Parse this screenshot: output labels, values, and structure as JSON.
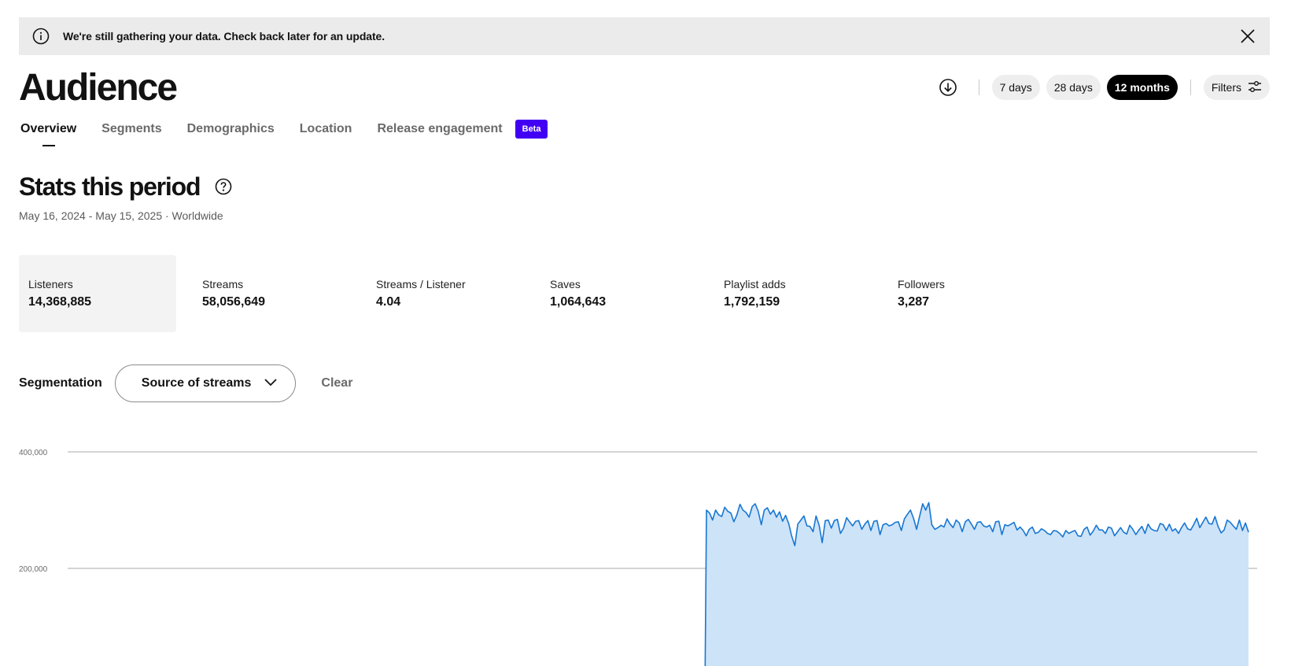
{
  "banner": {
    "message": "We're still gathering your data. Check back later for an update.",
    "icon": "info-icon",
    "close_icon": "close-icon"
  },
  "page": {
    "title": "Audience"
  },
  "time_range": {
    "options": [
      "7 days",
      "28 days",
      "12 months"
    ],
    "selected": "12 months"
  },
  "filters": {
    "label": "Filters",
    "icon": "sliders-icon"
  },
  "download": {
    "icon": "download-icon"
  },
  "tabs": [
    {
      "label": "Overview",
      "active": true
    },
    {
      "label": "Segments",
      "active": false
    },
    {
      "label": "Demographics",
      "active": false
    },
    {
      "label": "Location",
      "active": false
    },
    {
      "label": "Release engagement",
      "active": false,
      "badge": "Beta"
    }
  ],
  "stats_section": {
    "title": "Stats this period",
    "subtitle": "May 16, 2024 - May 15, 2025 · Worldwide",
    "stats": [
      {
        "label": "Listeners",
        "value": "14,368,885",
        "selected": true
      },
      {
        "label": "Streams",
        "value": "58,056,649",
        "selected": false
      },
      {
        "label": "Streams / Listener",
        "value": "4.04",
        "selected": false
      },
      {
        "label": "Saves",
        "value": "1,064,643",
        "selected": false
      },
      {
        "label": "Playlist adds",
        "value": "1,792,159",
        "selected": false
      },
      {
        "label": "Followers",
        "value": "3,287",
        "selected": false
      }
    ]
  },
  "segmentation": {
    "label": "Segmentation",
    "selected": "Source of streams",
    "clear_label": "Clear"
  },
  "colors": {
    "accent": "#4100f4",
    "line": "#1877d2",
    "fill": "#cde3f8",
    "text": "#121212"
  },
  "chart_data": {
    "type": "area",
    "yticks": [
      {
        "value": 400000,
        "label": "400,000"
      },
      {
        "value": 200000,
        "label": "200,000"
      }
    ],
    "ylim": [
      0,
      400000
    ],
    "x_range": [
      0,
      365
    ],
    "data_start_index": 184,
    "values": [
      0,
      0,
      0,
      0,
      0,
      0,
      0,
      0,
      0,
      0,
      0,
      0,
      0,
      0,
      0,
      0,
      0,
      0,
      0,
      0,
      0,
      0,
      0,
      0,
      0,
      0,
      0,
      0,
      0,
      0,
      0,
      0,
      0,
      0,
      0,
      0,
      0,
      0,
      0,
      0,
      0,
      0,
      0,
      0,
      0,
      0,
      0,
      0,
      0,
      0,
      0,
      0,
      0,
      0,
      0,
      0,
      0,
      0,
      0,
      0,
      0,
      0,
      0,
      0,
      0,
      0,
      0,
      0,
      0,
      0,
      0,
      0,
      0,
      0,
      0,
      0,
      0,
      0,
      0,
      0,
      0,
      0,
      0,
      0,
      0,
      0,
      0,
      0,
      0,
      0,
      0,
      0,
      0,
      0,
      0,
      0,
      0,
      0,
      0,
      0,
      0,
      0,
      0,
      0,
      0,
      0,
      0,
      0,
      0,
      0,
      0,
      0,
      0,
      0,
      0,
      0,
      0,
      0,
      0,
      0,
      0,
      0,
      0,
      0,
      0,
      0,
      0,
      0,
      0,
      0,
      0,
      0,
      0,
      0,
      0,
      0,
      0,
      0,
      0,
      0,
      0,
      0,
      0,
      0,
      0,
      0,
      0,
      0,
      0,
      0,
      0,
      0,
      0,
      0,
      0,
      0,
      0,
      0,
      0,
      0,
      0,
      0,
      0,
      0,
      0,
      0,
      0,
      0,
      0,
      0,
      0,
      0,
      0,
      0,
      0,
      0,
      0,
      0,
      0,
      0,
      0,
      0,
      0,
      0,
      300000,
      295000,
      283000,
      300000,
      292000,
      289000,
      305000,
      298000,
      295000,
      280000,
      292000,
      310000,
      300000,
      296000,
      288000,
      306000,
      311000,
      298000,
      275000,
      300000,
      304000,
      293000,
      300000,
      288000,
      297000,
      281000,
      291000,
      277000,
      255000,
      239000,
      276000,
      283000,
      290000,
      273000,
      272000,
      263000,
      290000,
      274000,
      244000,
      282000,
      283000,
      269000,
      282000,
      284000,
      260000,
      269000,
      287000,
      280000,
      273000,
      281000,
      282000,
      267000,
      276000,
      282000,
      265000,
      281000,
      282000,
      258000,
      275000,
      277000,
      273000,
      275000,
      279000,
      280000,
      265000,
      285000,
      293000,
      300000,
      286000,
      267000,
      290000,
      311000,
      300000,
      313000,
      275000,
      267000,
      270000,
      274000,
      271000,
      285000,
      276000,
      270000,
      283000,
      278000,
      263000,
      280000,
      284000,
      276000,
      267000,
      279000,
      280000,
      273000,
      271000,
      274000,
      263000,
      280000,
      281000,
      258000,
      275000,
      273000,
      276000,
      279000,
      266000,
      271000,
      265000,
      256000,
      267000,
      271000,
      260000,
      262000,
      268000,
      265000,
      260000,
      258000,
      265000,
      264000,
      260000,
      254000,
      265000,
      260000,
      263000,
      265000,
      256000,
      255000,
      267000,
      271000,
      257000,
      264000,
      274000,
      266000,
      266000,
      260000,
      271000,
      269000,
      256000,
      263000,
      270000,
      262000,
      259000,
      274000,
      267000,
      258000,
      266000,
      272000,
      260000,
      276000,
      268000,
      265000,
      264000,
      277000,
      275000,
      265000,
      276000,
      264000,
      268000,
      260000,
      270000,
      278000,
      268000,
      266000,
      275000,
      286000,
      270000,
      279000,
      288000,
      277000,
      276000,
      289000,
      272000,
      261000,
      266000,
      283000,
      279000,
      273000,
      267000,
      283000,
      265000,
      278000,
      262000
    ]
  }
}
